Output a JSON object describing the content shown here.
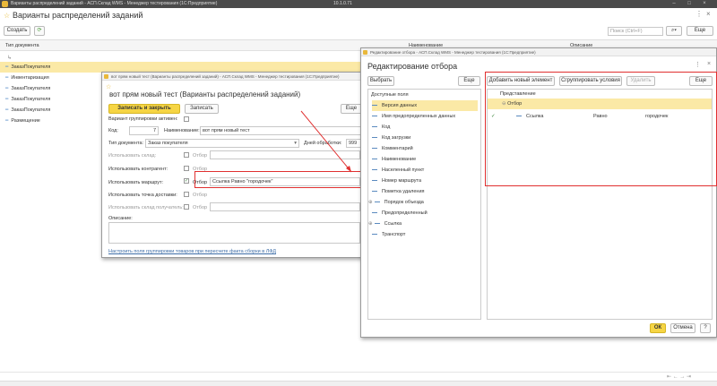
{
  "titlebar": {
    "app_title": "Варианты распределений заданий - АСП.Склад WMS - Менеджер тестирования (1С:Предприятие)",
    "center_ip": "10.1.0.71"
  },
  "main": {
    "title": "Варианты распределений заданий",
    "create_label": "Создать",
    "search_placeholder": "Поиск (Ctrl+F)",
    "more_label": "Еще",
    "columns": [
      "Тип документа",
      "Наименование",
      "Описание"
    ],
    "rows": [
      "ЗаказПокупателя",
      "Инвентаризация",
      "ЗаказПокупателя",
      "ЗаказПокупателя",
      "ЗаказПокупателя",
      "Размещение"
    ]
  },
  "form": {
    "window_title": "вот прям новый тест (Варианты распределений заданий) - АСП.Склад WMS - Менеджер тестирования (1С:Предприятие)",
    "title": "вот прям новый тест (Варианты распределений заданий)",
    "save_close_label": "Записать и закрыть",
    "save_label": "Записать",
    "more_label": "Еще",
    "group_label": "Вариант группировки активен:",
    "code_label": "Код:",
    "code_value": "7",
    "name_label": "Наименование:",
    "name_value": "вот прям новый тест",
    "doctype_label": "Тип документа:",
    "doctype_value": "Заказ покупателя",
    "days_label": "Дней обработки:",
    "days_value": "999",
    "use_warehouse_label": "Использовать склад:",
    "use_contractor_label": "Использовать контрагент:",
    "use_route_label": "Использовать маршрут:",
    "use_delivery_label": "Использовать точка доставки:",
    "use_recipient_label": "Использовать склад получатель:",
    "filter_label": "Отбор",
    "route_filter_value": "Ссылка Равно \"городочек\"",
    "description_label": "Описание:",
    "link_text": "Настроить поля группировки товаров при пересчете факта сборки в ЛФД"
  },
  "filter_dialog": {
    "window_title": "Редактирование отбора - АСП.Склад WMS - Менеджер тестирования (1С:Предприятие)",
    "title": "Редактирование отбора",
    "choose_label": "Выбрать",
    "more_label": "Еще",
    "available_fields_label": "Доступные поля",
    "fields": [
      "Версия данных",
      "Имя предопределенных данных",
      "Код",
      "Код загрузки",
      "Комментарий",
      "Наименование",
      "Населенный пункт",
      "Номер маршрута",
      "Пометка удаления",
      "Порядок объезда",
      "Предопределенный",
      "Ссылка",
      "Транспорт"
    ],
    "add_element_label": "Добавить новый элемент",
    "group_conditions_label": "Сгруппировать условия",
    "delete_label": "Удалить",
    "representation_label": "Представление",
    "filter_root": "Отбор",
    "condition": {
      "field": "Ссылка",
      "op": "Равно",
      "value": "городочек"
    },
    "ok_label": "ОК",
    "cancel_label": "Отмена",
    "help_label": "?"
  },
  "colors": {
    "accent_yellow": "#f6d544",
    "highlight_red": "#e03030",
    "row_selected": "#fbe9a6"
  },
  "icons": [
    "home-icon",
    "refresh-icon",
    "search-icon",
    "close-icon",
    "arrow-icon",
    "star-icon"
  ]
}
